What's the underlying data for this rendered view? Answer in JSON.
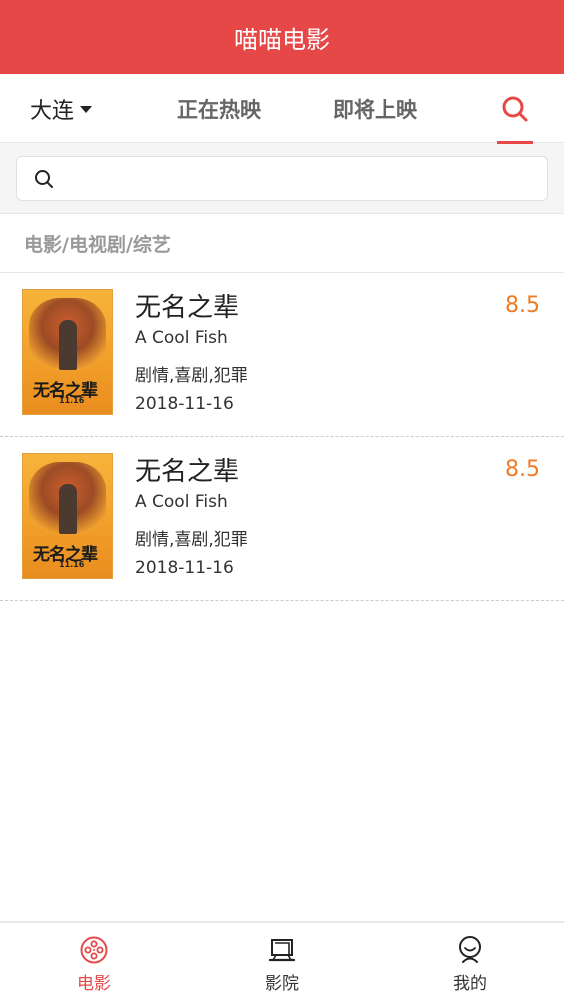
{
  "header": {
    "title": "喵喵电影"
  },
  "nav": {
    "city": "大连",
    "tabs": [
      {
        "label": "正在热映"
      },
      {
        "label": "即将上映"
      }
    ],
    "search_icon": "search-icon"
  },
  "search": {
    "value": "",
    "placeholder": ""
  },
  "section": {
    "title": "电影/电视剧/综艺"
  },
  "movies": [
    {
      "title": "无名之辈",
      "en_title": "A Cool Fish",
      "genre": "剧情,喜剧,犯罪",
      "date": "2018-11-16",
      "score": "8.5",
      "poster_title": "无名之辈",
      "poster_date": "11.16"
    },
    {
      "title": "无名之辈",
      "en_title": "A Cool Fish",
      "genre": "剧情,喜剧,犯罪",
      "date": "2018-11-16",
      "score": "8.5",
      "poster_title": "无名之辈",
      "poster_date": "11.16"
    }
  ],
  "tabbar": {
    "items": [
      {
        "label": "电影",
        "icon": "film-reel-icon",
        "active": true
      },
      {
        "label": "影院",
        "icon": "cinema-screen-icon",
        "active": false
      },
      {
        "label": "我的",
        "icon": "profile-icon",
        "active": false
      }
    ]
  },
  "colors": {
    "brand": "#e54847",
    "score": "#f07b26"
  }
}
